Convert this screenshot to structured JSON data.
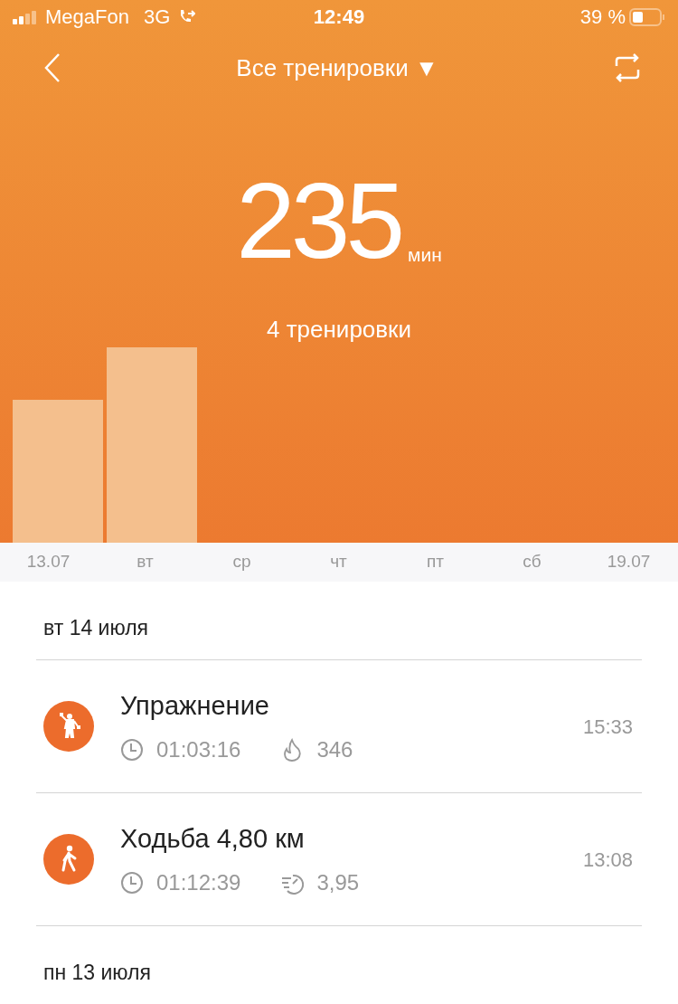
{
  "status_bar": {
    "carrier": "MegaFon",
    "network": "3G",
    "time": "12:49",
    "battery": "39 %"
  },
  "header": {
    "title": "Все тренировки ▼"
  },
  "summary": {
    "value": "235",
    "unit": "мин",
    "count": "4 тренировки"
  },
  "day_labels": [
    "13.07",
    "вт",
    "ср",
    "чт",
    "пт",
    "сб",
    "19.07"
  ],
  "days": [
    {
      "date": "вт 14 июля",
      "workouts": [
        {
          "kind": "exercise",
          "name": "Упражнение",
          "time": "15:33",
          "stats": [
            {
              "kind": "duration",
              "value": "01:03:16"
            },
            {
              "kind": "calories",
              "value": "346"
            }
          ]
        },
        {
          "kind": "walking",
          "name": "Ходьба 4,80 км",
          "time": "13:08",
          "stats": [
            {
              "kind": "duration",
              "value": "01:12:39"
            },
            {
              "kind": "pace",
              "value": "3,95"
            }
          ]
        }
      ]
    },
    {
      "date": "пн 13 июля"
    }
  ]
}
